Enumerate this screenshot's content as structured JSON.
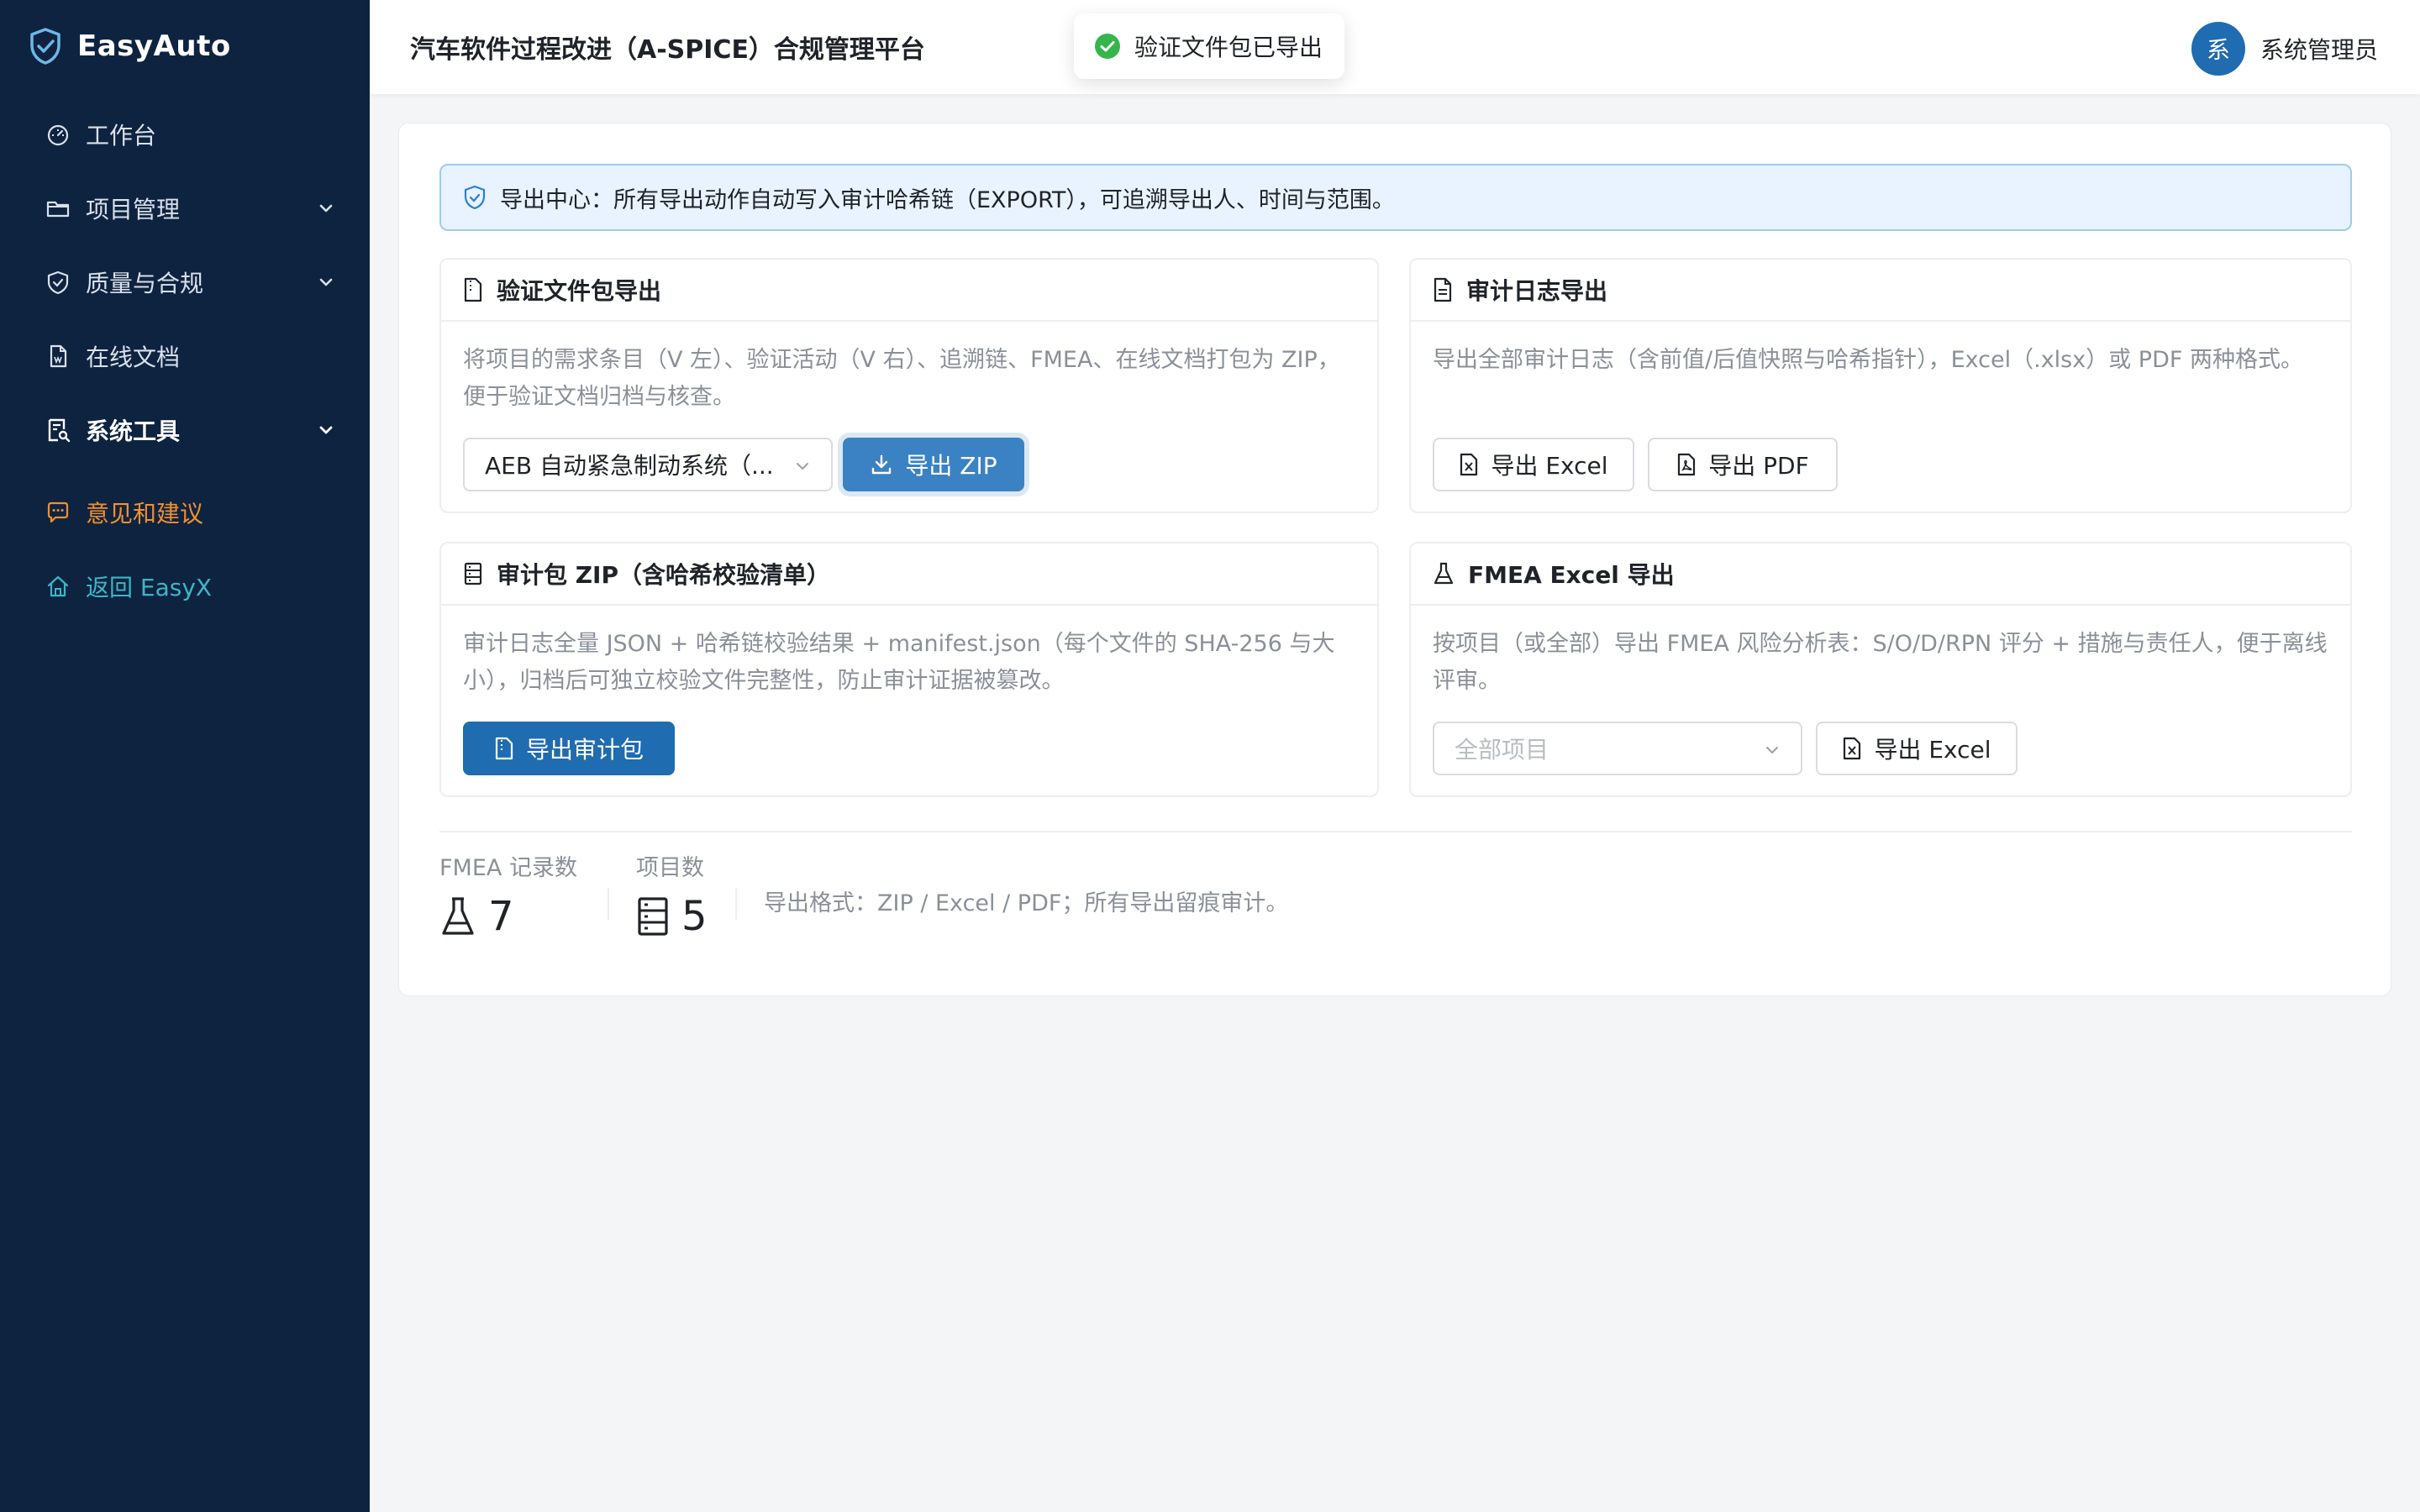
{
  "app": {
    "brand": "EasyAuto",
    "header_title": "汽车软件过程改进（A-SPICE）合规管理平台"
  },
  "user": {
    "avatar_text": "系",
    "name": "系统管理员"
  },
  "toast": {
    "message": "验证文件包已导出"
  },
  "sidebar": {
    "items": [
      {
        "label": "工作台",
        "icon": "dashboard-icon"
      },
      {
        "label": "项目管理",
        "icon": "folder-icon",
        "expandable": true
      },
      {
        "label": "质量与合规",
        "icon": "shield-icon",
        "expandable": true
      },
      {
        "label": "在线文档",
        "icon": "document-icon"
      },
      {
        "label": "系统工具",
        "icon": "tools-icon",
        "expandable": true,
        "active": true
      },
      {
        "label": "意见和建议",
        "icon": "chat-icon"
      },
      {
        "label": "返回 EasyX",
        "icon": "home-icon"
      }
    ]
  },
  "notice": {
    "text": "导出中心：所有导出动作自动写入审计哈希链（EXPORT），可追溯导出人、时间与范围。"
  },
  "cards": {
    "verification": {
      "title": "验证文件包导出",
      "desc": "将项目的需求条目（V 左）、验证活动（V 右）、追溯链、FMEA、在线文档打包为 ZIP，便于验证文档归档与核查。",
      "select_value": "AEB 自动紧急制动系统（...",
      "button": "导出 ZIP"
    },
    "audit_log": {
      "title": "审计日志导出",
      "desc": "导出全部审计日志（含前值/后值快照与哈希指针），Excel（.xlsx）或 PDF 两种格式。",
      "button_excel": "导出 Excel",
      "button_pdf": "导出 PDF"
    },
    "audit_package": {
      "title": "审计包 ZIP（含哈希校验清单）",
      "desc": "审计日志全量 JSON + 哈希链校验结果 + manifest.json（每个文件的 SHA-256 与大小），归档后可独立校验文件完整性，防止审计证据被篡改。",
      "button": "导出审计包"
    },
    "fmea": {
      "title": "FMEA Excel 导出",
      "desc": "按项目（或全部）导出 FMEA 风险分析表：S/O/D/RPN 评分 + 措施与责任人，便于离线评审。",
      "select_placeholder": "全部项目",
      "button": "导出 Excel"
    }
  },
  "stats": {
    "fmea_label": "FMEA 记录数",
    "fmea_value": "7",
    "project_label": "项目数",
    "project_value": "5",
    "footnote": "导出格式：ZIP / Excel / PDF；所有导出留痕审计。"
  }
}
